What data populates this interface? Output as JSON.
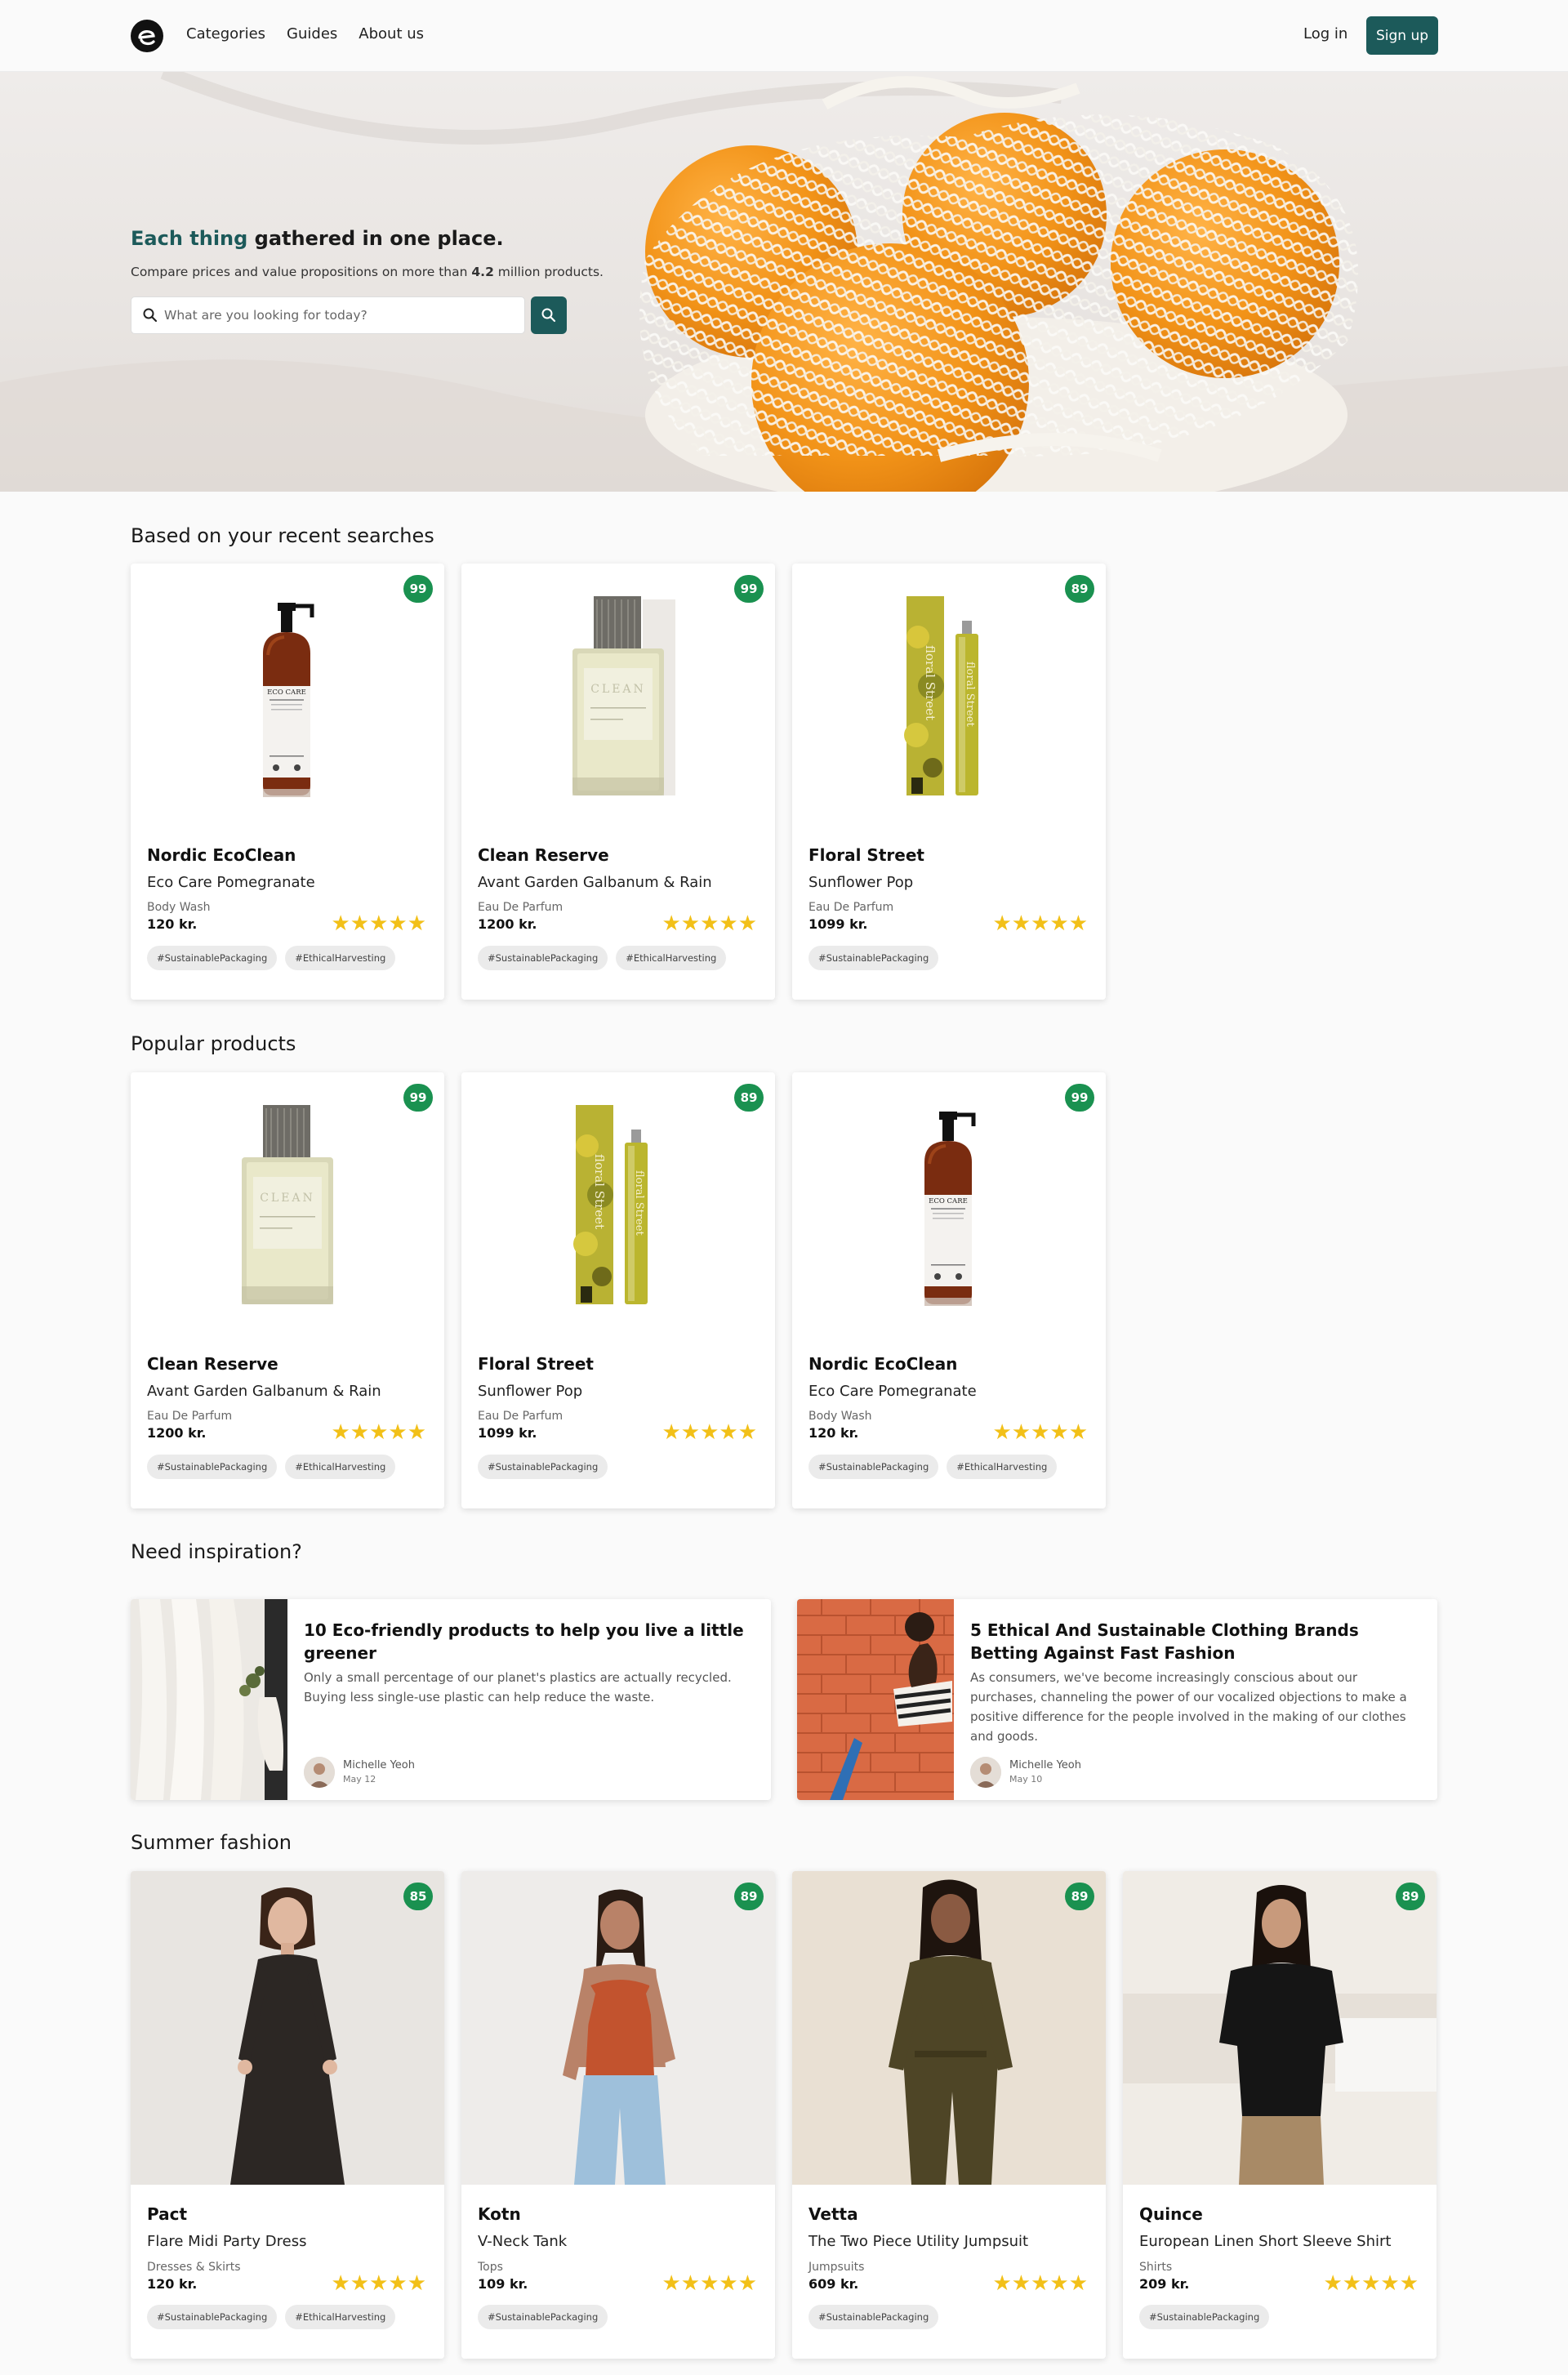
{
  "nav": {
    "logo": "logo-icon",
    "links": [
      "Categories",
      "Guides",
      "About us"
    ],
    "login": "Log in",
    "signup": "Sign up"
  },
  "hero": {
    "title_accent": "Each thing",
    "title_rest": " gathered in one place.",
    "sub_prefix": "Compare prices and value propositions on more than ",
    "sub_bold": "4.2",
    "sub_suffix": " million products.",
    "search_placeholder": "What are you looking for today?"
  },
  "sections": {
    "recent": "Based on your recent searches",
    "popular": "Popular products",
    "inspiration": "Need inspiration?",
    "summer": "Summer fashion"
  },
  "recent_products": [
    {
      "score": "99",
      "brand": "Nordic EcoClean",
      "name": "Eco Care Pomegranate",
      "category": "Body Wash",
      "price": "120 kr.",
      "rating": 5,
      "tags": [
        "#SustainablePackaging",
        "#EthicalHarvesting"
      ]
    },
    {
      "score": "99",
      "brand": "Clean Reserve",
      "name": "Avant Garden Galbanum & Rain",
      "category": "Eau De Parfum",
      "price": "1200 kr.",
      "rating": 5,
      "tags": [
        "#SustainablePackaging",
        "#EthicalHarvesting"
      ]
    },
    {
      "score": "89",
      "brand": "Floral Street",
      "name": "Sunflower Pop",
      "category": "Eau De Parfum",
      "price": "1099 kr.",
      "rating": 5,
      "tags": [
        "#SustainablePackaging"
      ]
    }
  ],
  "popular_products": [
    {
      "score": "99",
      "brand": "Clean Reserve",
      "name": "Avant Garden Galbanum & Rain",
      "category": "Eau De Parfum",
      "price": "1200 kr.",
      "rating": 5,
      "tags": [
        "#SustainablePackaging",
        "#EthicalHarvesting"
      ]
    },
    {
      "score": "89",
      "brand": "Floral Street",
      "name": "Sunflower Pop",
      "category": "Eau De Parfum",
      "price": "1099 kr.",
      "rating": 5,
      "tags": [
        "#SustainablePackaging"
      ]
    },
    {
      "score": "99",
      "brand": "Nordic EcoClean",
      "name": "Eco Care Pomegranate",
      "category": "Body Wash",
      "price": "120 kr.",
      "rating": 5,
      "tags": [
        "#SustainablePackaging",
        "#EthicalHarvesting"
      ]
    }
  ],
  "articles": [
    {
      "title": "10 Eco-friendly products to help you live a little greener",
      "excerpt": "Only a small percentage of our planet's plastics are actually recycled. Buying less single-use plastic can help reduce the waste.",
      "author": "Michelle Yeoh",
      "date": "May 12"
    },
    {
      "title": "5 Ethical And Sustainable Clothing Brands Betting Against Fast Fashion",
      "excerpt": "As consumers, we've become increasingly conscious about our purchases, channeling the power of our vocalized objections to make a positive difference for the people involved in the making of our clothes and goods.",
      "author": "Michelle Yeoh",
      "date": "May 10"
    }
  ],
  "fashion_products": [
    {
      "score": "85",
      "brand": "Pact",
      "name": "Flare Midi Party Dress",
      "category": "Dresses & Skirts",
      "price": "120 kr.",
      "rating": 5,
      "tags": [
        "#SustainablePackaging",
        "#EthicalHarvesting"
      ]
    },
    {
      "score": "89",
      "brand": "Kotn",
      "name": "V-Neck Tank",
      "category": "Tops",
      "price": "109 kr.",
      "rating": 5,
      "tags": [
        "#SustainablePackaging"
      ]
    },
    {
      "score": "89",
      "brand": "Vetta",
      "name": "The Two Piece Utility Jumpsuit",
      "category": "Jumpsuits",
      "price": "609 kr.",
      "rating": 5,
      "tags": [
        "#SustainablePackaging"
      ]
    },
    {
      "score": "89",
      "brand": "Quince",
      "name": "European Linen Short Sleeve Shirt",
      "category": "Shirts",
      "price": "209 kr.",
      "rating": 5,
      "tags": [
        "#SustainablePackaging"
      ]
    }
  ],
  "colors": {
    "accent": "#1c5a5a",
    "score_green": "#1a9150",
    "star": "#f2c018"
  }
}
